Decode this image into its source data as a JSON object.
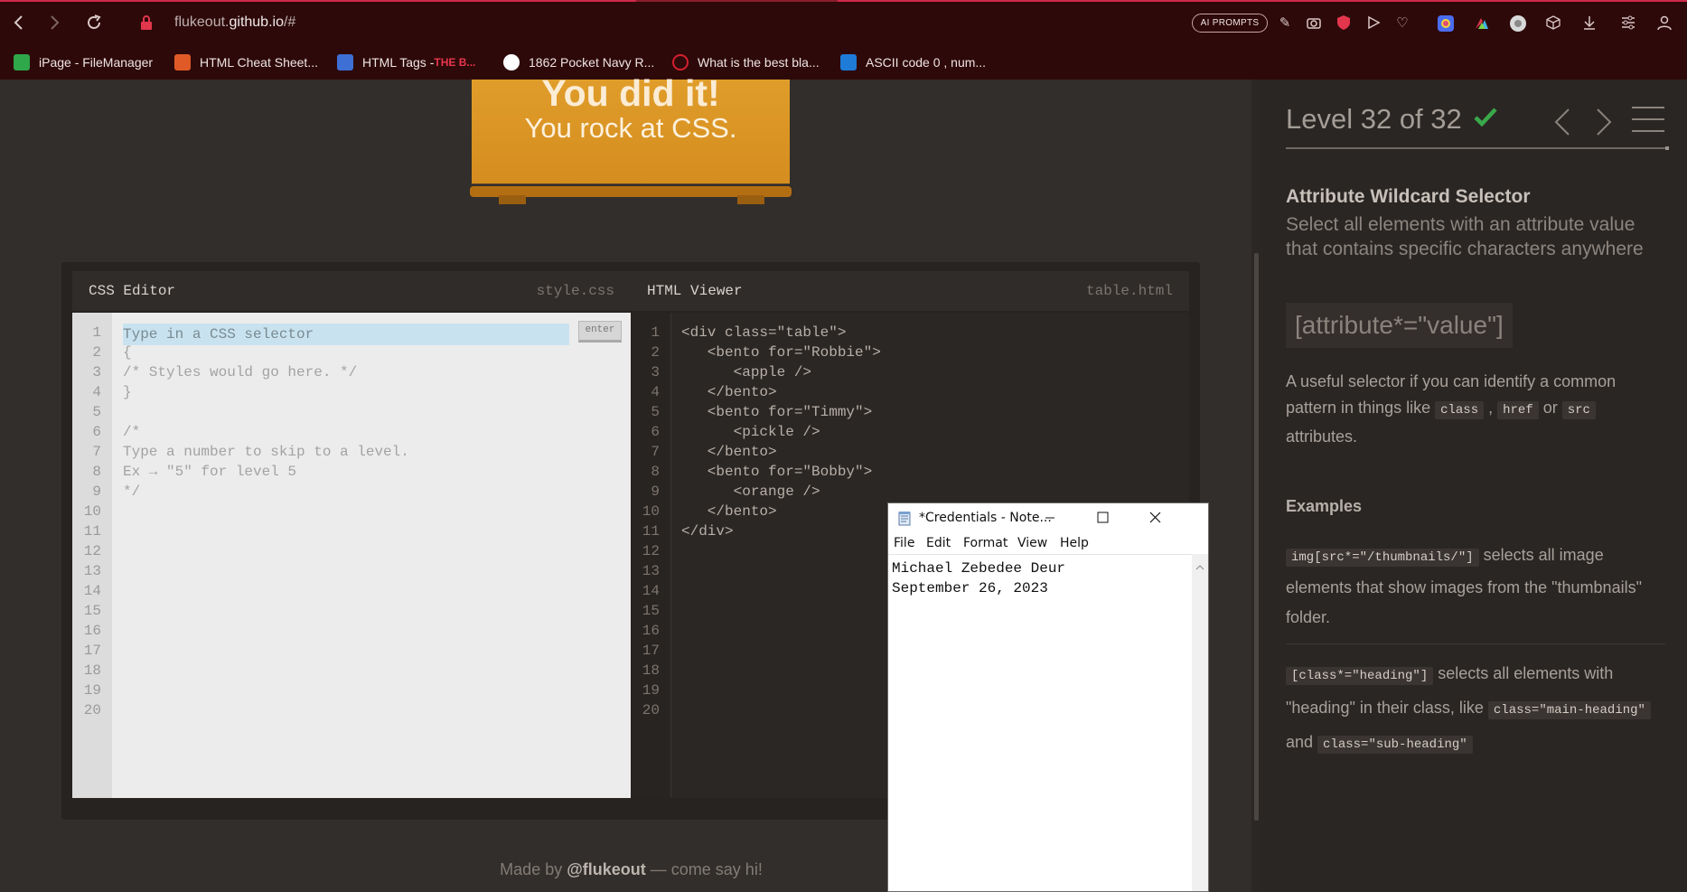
{
  "browser": {
    "url_prefix": "flukeout.",
    "url_domain": "github.io",
    "url_suffix": "/#",
    "ai_prompts_label": "AI PROMPTS",
    "bookmarks": [
      {
        "label": "iPage - FileManager",
        "color": "#2ea84a"
      },
      {
        "label": "HTML Cheat Sheet...",
        "color": "#e05a28"
      },
      {
        "label": "HTML Tags - ",
        "bold": "THE B...",
        "color": "#3d6fd4"
      },
      {
        "label": "1862 Pocket Navy R...",
        "color": "#ffffff"
      },
      {
        "label": "What is the best bla...",
        "color": "#d32030"
      },
      {
        "label": "ASCII code 0 , num...",
        "color": "#1e7bd8"
      }
    ]
  },
  "game": {
    "banner_line1": "You did it!",
    "banner_line2": "You rock at CSS.",
    "css_editor": {
      "title": "CSS Editor",
      "file": "style.css",
      "placeholder": "Type in a CSS selector",
      "enter_label": "enter",
      "lines": [
        "{",
        "/* Styles would go here. */",
        "}",
        "",
        "/*",
        "Type a number to skip to a level.",
        "Ex → \"5\" for level 5",
        "*/"
      ]
    },
    "html_viewer": {
      "title": "HTML Viewer",
      "file": "table.html",
      "lines": [
        "<div class=\"table\">",
        "   <bento for=\"Robbie\">",
        "      <apple />",
        "   </bento>",
        "   <bento for=\"Timmy\">",
        "      <pickle />",
        "   </bento>",
        "   <bento for=\"Bobby\">",
        "      <orange />",
        "   </bento>",
        "</div>"
      ]
    },
    "line_numbers": [
      "1",
      "2",
      "3",
      "4",
      "5",
      "6",
      "7",
      "8",
      "9",
      "10",
      "11",
      "12",
      "13",
      "14",
      "15",
      "16",
      "17",
      "18",
      "19",
      "20"
    ],
    "footer_pre": "Made by ",
    "footer_handle": "@flukeout",
    "footer_post": " — come say hi!"
  },
  "sidebar": {
    "level": "Level 32 of 32",
    "selector_name": "Attribute Wildcard Selector",
    "selector_desc": "Select all elements with an attribute value that contains specific characters anywhere",
    "syntax": "[attribute*=\"value\"]",
    "hint_pre": "A useful selector if you can identify a common pattern in things like ",
    "hint_code1": "class",
    "hint_sep": " , ",
    "hint_code2": "href",
    "hint_or": " or ",
    "hint_code3": "src",
    "hint_post": " attributes.",
    "examples_title": "Examples",
    "ex1_code": "img[src*=\"/thumbnails/\"]",
    "ex1_text": " selects all image elements that show images from the \"thumbnails\" folder.",
    "ex2_code": "[class*=\"heading\"]",
    "ex2_text1": " selects all elements with \"heading\" in their class, like ",
    "ex2_code2": "class=\"main-heading\"",
    "ex2_and": " and ",
    "ex2_code3": "class=\"sub-heading\""
  },
  "notepad": {
    "title": "*Credentials - Note...",
    "menus": [
      "File",
      "Edit",
      "Format",
      "View",
      "Help"
    ],
    "line1": "Michael Zebedee Deur",
    "line2": "September 26, 2023"
  },
  "colors": {
    "accent": "#e09d2a",
    "check": "#3aa84a",
    "browser_bg": "#2e0909"
  }
}
